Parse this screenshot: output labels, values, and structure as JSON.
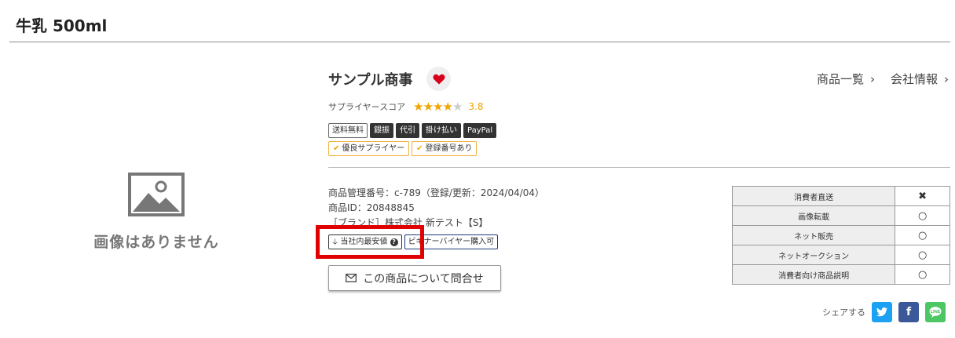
{
  "product": {
    "title": "牛乳 500ml"
  },
  "image": {
    "placeholder_text": "画像はありません"
  },
  "supplier": {
    "name": "サンプル商事",
    "score_label": "サプライヤースコア",
    "score_value": "3.8",
    "rating_stars": 4,
    "rating_max": 5
  },
  "nav_links": [
    {
      "label": "商品一覧",
      "chevron": "›"
    },
    {
      "label": "会社情報",
      "chevron": "›"
    }
  ],
  "payment_badges": [
    {
      "label": "送料無料",
      "style": "outline"
    },
    {
      "label": "銀振",
      "style": "dark"
    },
    {
      "label": "代引",
      "style": "dark"
    },
    {
      "label": "掛け払い",
      "style": "dark"
    },
    {
      "label": "PayPal",
      "style": "dark"
    }
  ],
  "quality_badges": [
    {
      "label": "優良サプライヤー",
      "icon": "check-icon"
    },
    {
      "label": "登録番号あり",
      "icon": "check-icon"
    }
  ],
  "info_lines": {
    "management_no": "商品管理番号：c-789（登録/更新：2024/04/04）",
    "product_id": "商品ID：20848845",
    "brand": "［ブランド］株式会社 新テスト【S】"
  },
  "tags": [
    {
      "label": "当社内最安値",
      "icon": "arrow-down-icon",
      "suffix_icon": "help-icon"
    },
    {
      "label": "ビギナーバイヤー購入可"
    }
  ],
  "inquiry_button": {
    "label": "この商品について問合せ",
    "icon": "mail-icon"
  },
  "attributes": [
    {
      "label": "消費者直送",
      "mark": "✖"
    },
    {
      "label": "画像転載",
      "mark": "○"
    },
    {
      "label": "ネット販売",
      "mark": "○"
    },
    {
      "label": "ネットオークション",
      "mark": "○"
    },
    {
      "label": "消費者向け商品説明",
      "mark": "○"
    }
  ],
  "share": {
    "label": "シェアする",
    "buttons": [
      {
        "name": "twitter-icon",
        "color": "#1da1f2"
      },
      {
        "name": "facebook-icon",
        "color": "#3b5998"
      },
      {
        "name": "line-icon",
        "color": "#4cc764"
      }
    ]
  },
  "colors": {
    "accent_star": "#f0a500",
    "heart": "#d9001b",
    "highlight": "#e00000"
  }
}
